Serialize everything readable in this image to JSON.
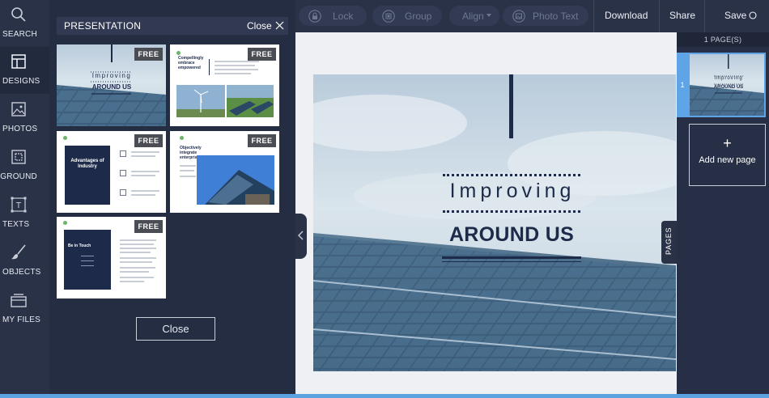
{
  "sidebar": {
    "items": [
      {
        "label": "SEARCH",
        "icon": "search-icon"
      },
      {
        "label": "DESIGNS",
        "icon": "layout-icon"
      },
      {
        "label": "PHOTOS",
        "icon": "image-icon"
      },
      {
        "label": "CKGROUND",
        "icon": "texture-icon"
      },
      {
        "label": "TEXTS",
        "icon": "text-icon"
      },
      {
        "label": "OBJECTS",
        "icon": "brush-icon"
      },
      {
        "label": "MY FILES",
        "icon": "folder-icon"
      }
    ]
  },
  "panel": {
    "title": "PRESENTATION",
    "close_label": "Close",
    "close_button": "Close",
    "templates": [
      {
        "badge": "FREE",
        "line1": "Improving",
        "line2": "AROUND US"
      },
      {
        "badge": "FREE",
        "heading": "Compellingly embrace empowered"
      },
      {
        "badge": "FREE",
        "heading": "Advantages of Industry"
      },
      {
        "badge": "FREE",
        "heading": "Objectively integrate enterprise-wide"
      },
      {
        "badge": "FREE",
        "heading": "Be in Touch"
      }
    ]
  },
  "toolbar": {
    "lock": "Lock",
    "group": "Group",
    "align": "Align",
    "photo_text": "Photo Text",
    "download": "Download",
    "share": "Share",
    "save": "Save"
  },
  "slide": {
    "line1": "Improving",
    "line2": "AROUND US"
  },
  "pages": {
    "tab_label": "PAGES",
    "count_label": "1 PAGE(S)",
    "items": [
      {
        "number": "1",
        "line1": "Improving",
        "line2": "AROUND US"
      }
    ],
    "add_label": "Add new page",
    "add_symbol": "+"
  },
  "colors": {
    "navy": "#1d2a4a",
    "accent_blue": "#5ea4e6",
    "sidebar_bg": "#2a3248",
    "canvas_bg": "#eef0f3"
  }
}
